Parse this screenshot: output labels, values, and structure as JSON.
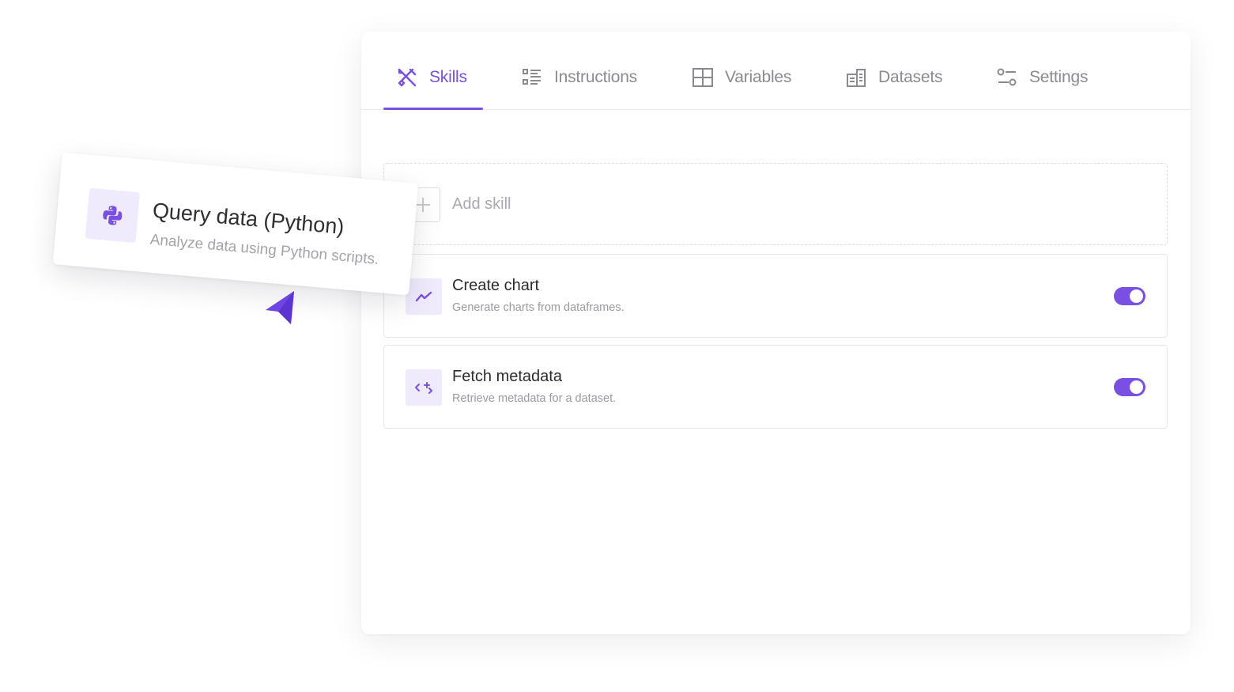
{
  "tabs": [
    {
      "label": "Skills",
      "icon": "tools-icon",
      "active": true
    },
    {
      "label": "Instructions",
      "icon": "list-icon",
      "active": false
    },
    {
      "label": "Variables",
      "icon": "grid-icon",
      "active": false
    },
    {
      "label": "Datasets",
      "icon": "database-icon",
      "active": false
    },
    {
      "label": "Settings",
      "icon": "sliders-icon",
      "active": false
    }
  ],
  "add_skill": {
    "label": "Add skill",
    "icon": "plus-icon"
  },
  "skills": [
    {
      "title": "Create chart",
      "description": "Generate charts from dataframes.",
      "icon": "chart-line-icon",
      "enabled": true
    },
    {
      "title": "Fetch metadata",
      "description": "Retrieve metadata for a dataset.",
      "icon": "code-sparkle-icon",
      "enabled": true
    }
  ],
  "dragging_card": {
    "title": "Query data (Python)",
    "description": "Analyze data using Python scripts.",
    "icon": "python-icon"
  },
  "colors": {
    "accent": "#7a4fe3",
    "accent_light": "#efeafc",
    "text": "#2b2b30",
    "muted": "#9a9aa2"
  }
}
